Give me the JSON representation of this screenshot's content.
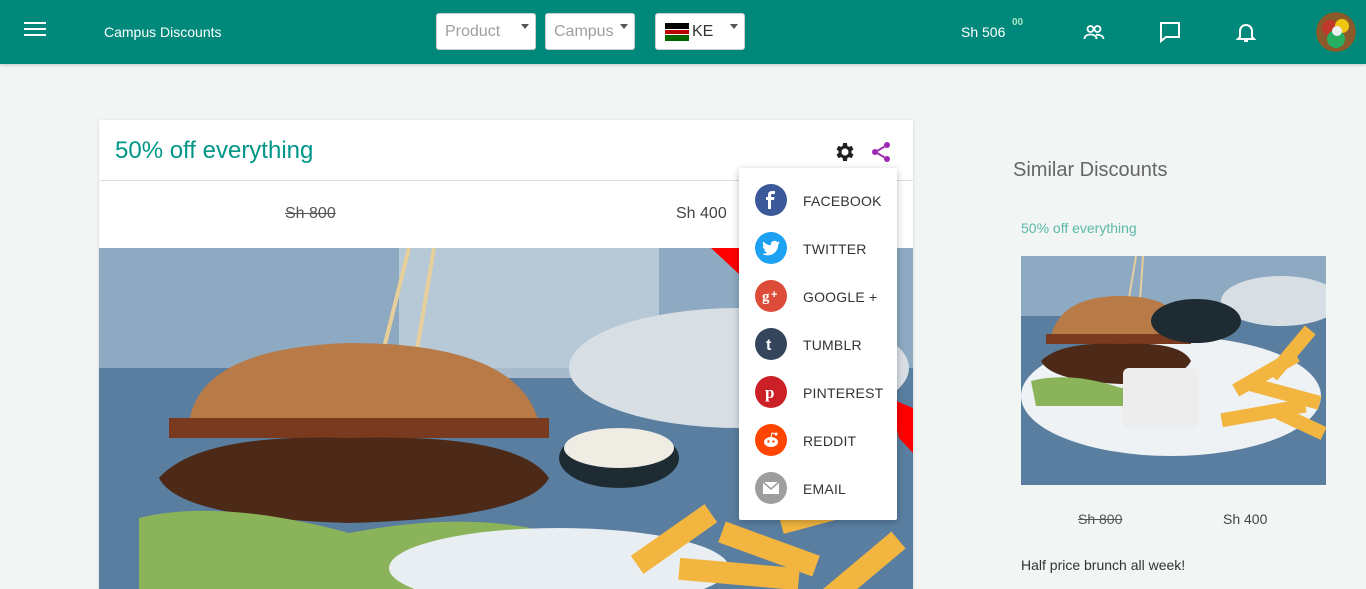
{
  "topbar": {
    "title": "Campus Discounts",
    "product_placeholder": "Product",
    "campus_placeholder": "Campus",
    "country_code": "KE",
    "balance": "Sh 506",
    "balance_cents": "00",
    "color": "#00897b"
  },
  "icons": {
    "menu": "menu-icon",
    "users": "people-icon",
    "chat": "chat-icon",
    "bell": "bell-icon",
    "settings": "gear-icon",
    "share": "share-icon"
  },
  "card": {
    "title": "50% off everything",
    "old_price": "Sh 800",
    "new_price": "Sh 400",
    "accent": "#009688"
  },
  "share_menu": {
    "items": [
      {
        "label": "FACEBOOK",
        "color": "#3b5998",
        "icon": "facebook-icon"
      },
      {
        "label": "TWITTER",
        "color": "#1da1f2",
        "icon": "twitter-icon"
      },
      {
        "label": "GOOGLE +",
        "color": "#dd4b39",
        "icon": "google-plus-icon"
      },
      {
        "label": "TUMBLR",
        "color": "#35465c",
        "icon": "tumblr-icon"
      },
      {
        "label": "PINTEREST",
        "color": "#cb2027",
        "icon": "pinterest-icon"
      },
      {
        "label": "REDDIT",
        "color": "#ff4500",
        "icon": "reddit-icon"
      },
      {
        "label": "EMAIL",
        "color": "#9e9e9e",
        "icon": "email-icon"
      }
    ]
  },
  "similar": {
    "heading": "Similar Discounts",
    "item_title": "50% off everything",
    "old_price": "Sh 800",
    "new_price": "Sh 400",
    "description": "Half price brunch all week!"
  }
}
